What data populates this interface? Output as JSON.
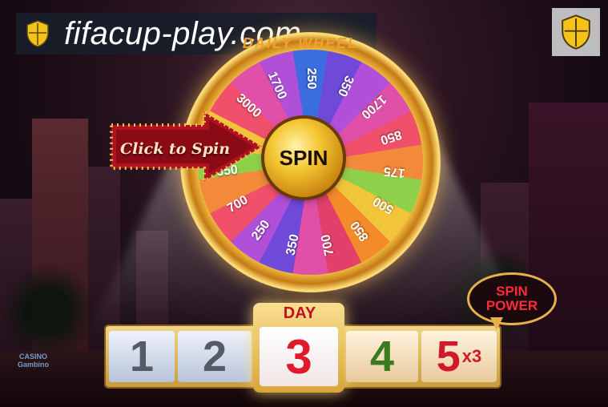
{
  "site": {
    "domain": "fifacup-play.com",
    "badge_icon": "shield-icon"
  },
  "wheel": {
    "title": "DAILY WHEEL",
    "center_label": "SPIN",
    "segments": [
      "250",
      "350",
      "1700",
      "850",
      "175",
      "500",
      "850",
      "700",
      "350",
      "250",
      "700",
      "350",
      "175",
      "3000",
      "1700"
    ],
    "cta": "Click to Spin"
  },
  "days": {
    "tab_label": "DAY",
    "items": [
      {
        "num": "1",
        "state": "past"
      },
      {
        "num": "2",
        "state": "past"
      },
      {
        "num": "3",
        "state": "current"
      },
      {
        "num": "4",
        "state": "future"
      },
      {
        "num": "5",
        "state": "future",
        "multiplier": "x3"
      }
    ]
  },
  "spin_power": {
    "line1": "SPIN",
    "line2": "POWER"
  },
  "brand_logo": {
    "line1": "CASINO",
    "line2": "Gambino"
  },
  "colors": {
    "accent_gold": "#f4c632",
    "red": "#e01a2a",
    "green": "#3c7a1e"
  }
}
